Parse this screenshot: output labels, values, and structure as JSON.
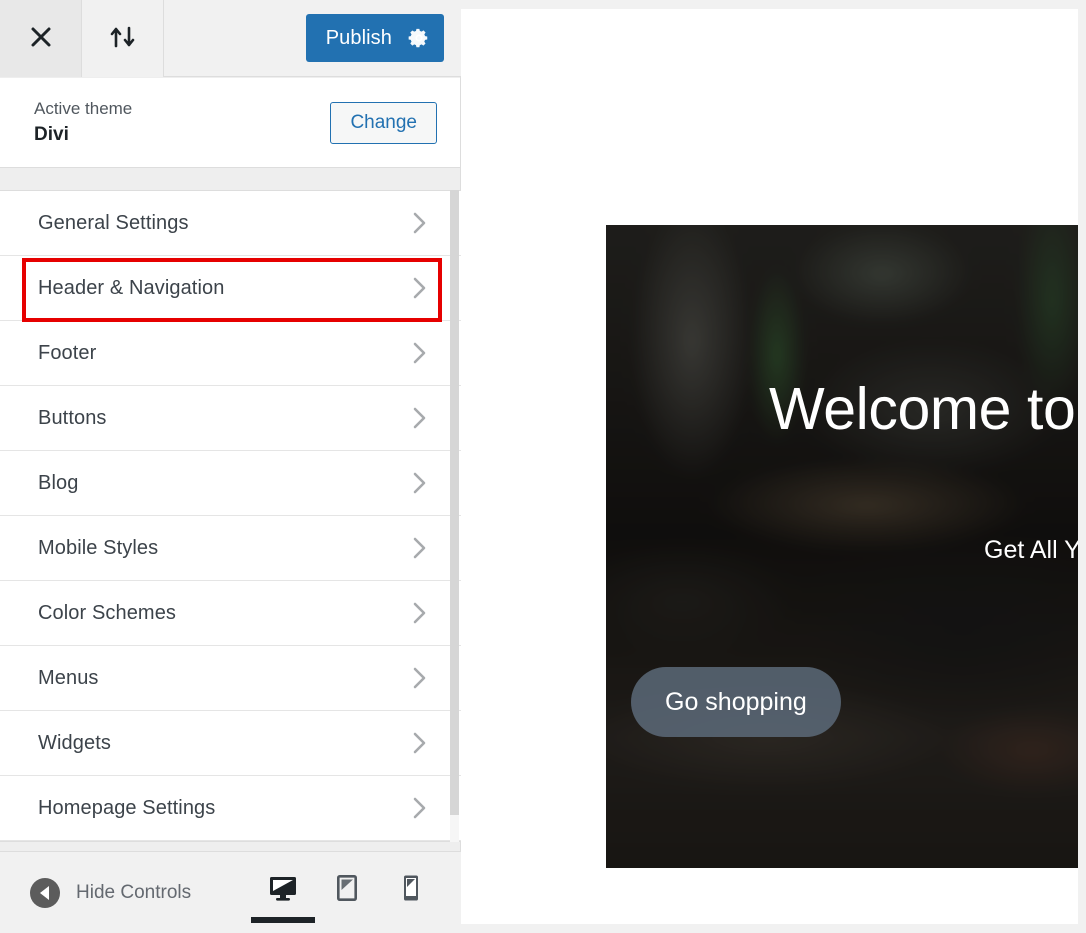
{
  "sidebar": {
    "header": {
      "close_icon": "close-icon",
      "changeset_icon": "up-down-arrows-icon",
      "publish_label": "Publish",
      "publish_gear_icon": "gear-icon",
      "publish_color": "#2271b1"
    },
    "theme": {
      "kicker": "Active theme",
      "name": "Divi",
      "change_label": "Change"
    },
    "sections": [
      {
        "label": "General Settings",
        "chevron": "chevron-right-icon",
        "highlighted": false
      },
      {
        "label": "Header & Navigation",
        "chevron": "chevron-right-icon",
        "highlighted": true
      },
      {
        "label": "Footer",
        "chevron": "chevron-right-icon",
        "highlighted": false
      },
      {
        "label": "Buttons",
        "chevron": "chevron-right-icon",
        "highlighted": false
      },
      {
        "label": "Blog",
        "chevron": "chevron-right-icon",
        "highlighted": false
      },
      {
        "label": "Mobile Styles",
        "chevron": "chevron-right-icon",
        "highlighted": false
      },
      {
        "label": "Color Schemes",
        "chevron": "chevron-right-icon",
        "highlighted": false
      },
      {
        "label": "Menus",
        "chevron": "chevron-right-icon",
        "highlighted": false
      },
      {
        "label": "Widgets",
        "chevron": "chevron-right-icon",
        "highlighted": false
      },
      {
        "label": "Homepage Settings",
        "chevron": "chevron-right-icon",
        "highlighted": false
      }
    ],
    "highlight_color": "#e60000",
    "bottom": {
      "collapse_label": "Hide Controls",
      "collapse_icon": "circle-left-arrow-icon",
      "devices": [
        {
          "name": "desktop",
          "icon": "desktop-icon",
          "active": true
        },
        {
          "name": "tablet",
          "icon": "tablet-icon",
          "active": false
        },
        {
          "name": "mobile",
          "icon": "mobile-icon",
          "active": false
        }
      ]
    }
  },
  "preview": {
    "hero": {
      "title": "Welcome to",
      "subtitle": "Get All Y",
      "cta_label": "Go shopping"
    }
  }
}
